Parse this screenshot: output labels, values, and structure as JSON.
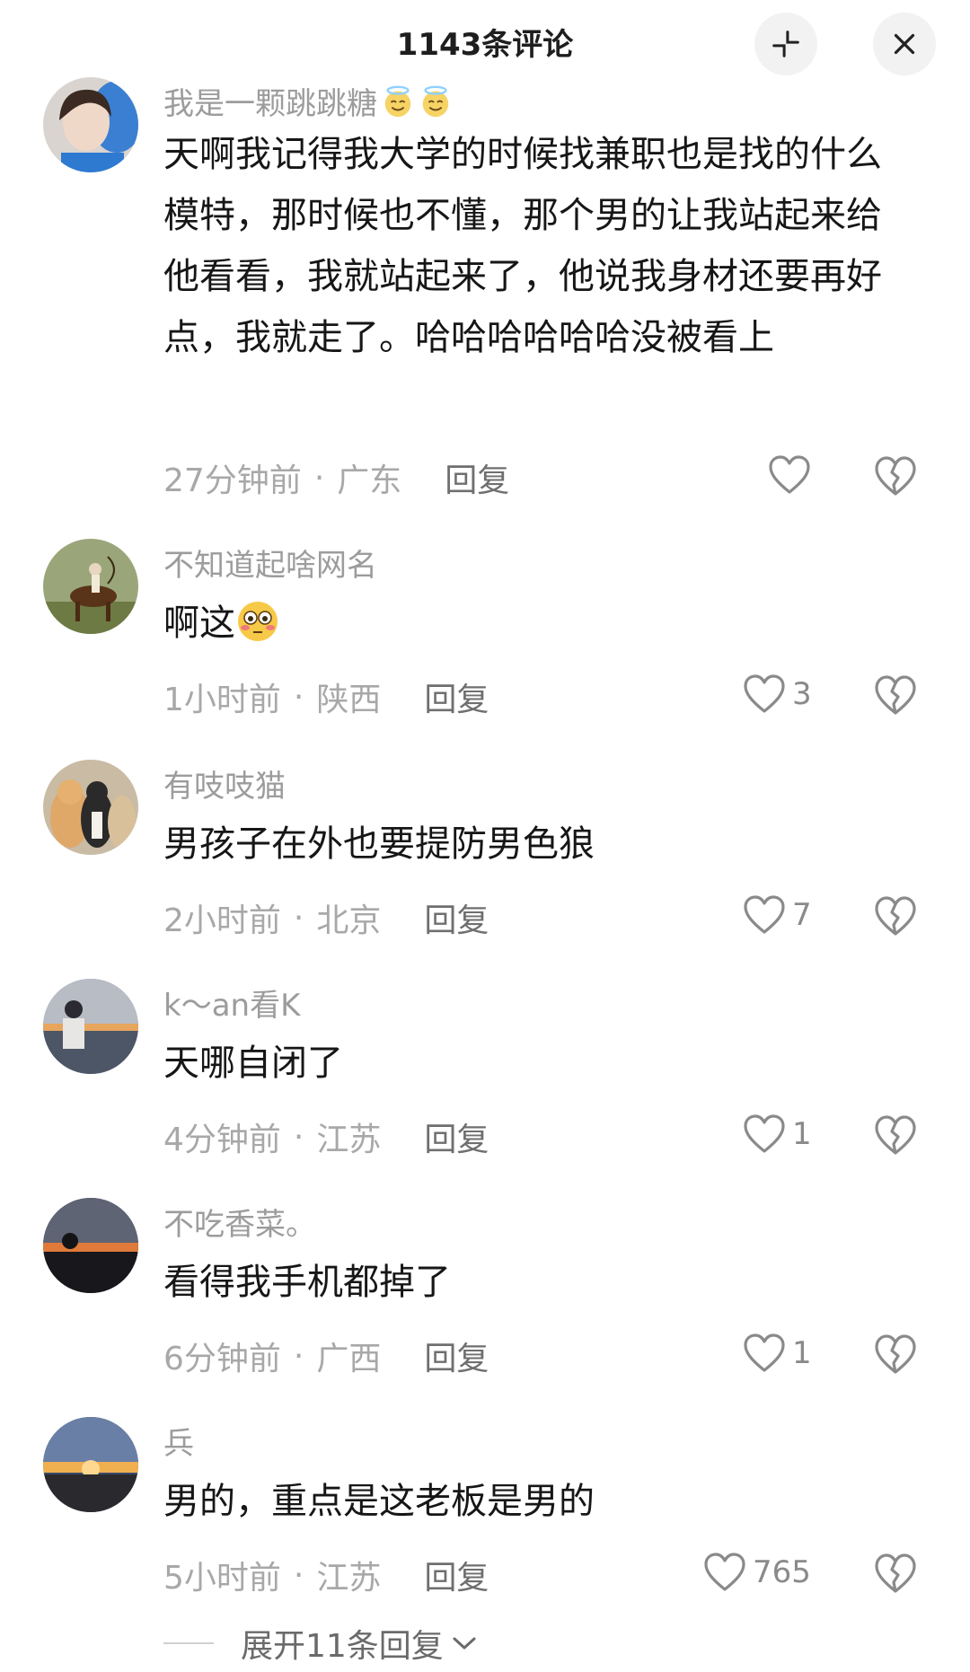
{
  "header": {
    "title": "1143条评论",
    "collapse_icon": "collapse-icon",
    "close_icon": "close-icon"
  },
  "comments": [
    {
      "username": "我是一颗跳跳糖",
      "username_emoji": "angel-halo-emoji",
      "text": "天啊我记得我大学的时候找兼职也是找的什么模特，那时候也不懂，那个男的让我站起来给他看看，我就站起来了，他说我身材还要再好点，我就走了。哈哈哈哈哈哈没被看上",
      "time": "27分钟前",
      "location": "广东",
      "reply": "回复",
      "likes": ""
    },
    {
      "username": "不知道起啥网名",
      "text": "啊这",
      "text_emoji": "flushed-face-emoji",
      "time": "1小时前",
      "location": "陕西",
      "reply": "回复",
      "likes": "3"
    },
    {
      "username": "有吱吱猫",
      "text": "男孩子在外也要提防男色狼",
      "time": "2小时前",
      "location": "北京",
      "reply": "回复",
      "likes": "7"
    },
    {
      "username": "k～an看K",
      "text": "天哪自闭了",
      "time": "4分钟前",
      "location": "江苏",
      "reply": "回复",
      "likes": "1"
    },
    {
      "username": "不吃香菜。",
      "text": "看得我手机都掉了",
      "time": "6分钟前",
      "location": "广西",
      "reply": "回复",
      "likes": "1"
    },
    {
      "username": "兵",
      "text": "男的，重点是这老板是男的",
      "time": "5小时前",
      "location": "江苏",
      "reply": "回复",
      "likes": "765"
    }
  ],
  "meta_separator": "·",
  "expand_replies": "展开11条回复",
  "colors": {
    "username": "#9c9c9c",
    "body_text": "#161616",
    "meta_text": "#a8a8a8",
    "icon_gray": "#8a8a8a"
  }
}
